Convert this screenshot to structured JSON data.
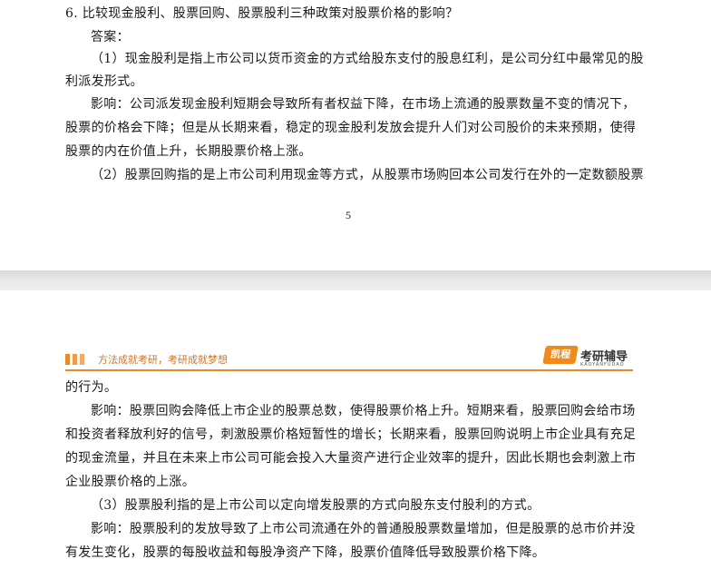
{
  "page1": {
    "lines": [
      "6.  比较现金股利、股票回购、股票股利三种政策对股票价格的影响？",
      "答案：",
      "（1）现金股利是指上市公司以货币资金的方式给股东支付的股息红利，是公司分红中最常见的股",
      "利派发形式。",
      "影响：公司派发现金股利短期会导致所有者权益下降，在市场上流通的股票数量不变的情况下，",
      "股票的价格会下降；但是从长期来看，稳定的现金股利发放会提升人们对公司股价的未来预期，使得",
      "股票的内在价值上升，长期股票价格上涨。",
      "（2）股票回购指的是上市公司利用现金等方式，从股票市场购回本公司发行在外的一定数额股票"
    ],
    "page_number": "5"
  },
  "header": {
    "slogan": "方法成就考研，考研成就梦想",
    "logo_badge": "凯程",
    "logo_text": "考研辅导",
    "logo_sub": "KAOYANFUDAO"
  },
  "page2": {
    "lines": [
      "的行为。",
      "影响：股票回购会降低上市企业的股票总数，使得股票价格上升。短期来看，股票回购会给市场",
      "和投资者释放利好的信号，刺激股票价格短暂性的增长；长期来看，股票回购说明上市企业具有充足",
      "的现金流量，并且在未来上市公司可能会投入大量资产进行企业效率的提升，因此长期也会刺激上市",
      "企业股票价格的上涨。",
      "（3）股票股利指的是上市公司以定向增发股票的方式向股东支付股利的方式。",
      "影响：股票股利的发放导致了上市公司流通在外的普通股股票数量增加，但是股票的总市价并没",
      "有发生变化，股票的每股收益和每股净资产下降，股票价值降低导致股票价格下降。"
    ]
  },
  "colors": {
    "accent": "#e88a2a",
    "slogan": "#c7782f"
  }
}
